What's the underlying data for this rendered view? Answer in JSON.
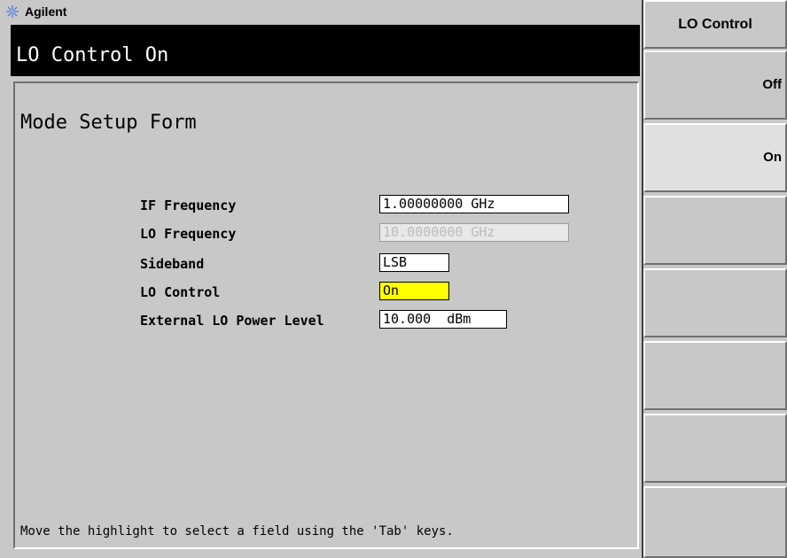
{
  "logo": {
    "brand": "Agilent"
  },
  "title_bar": {
    "text": "LO Control On"
  },
  "form": {
    "title": "Mode Setup Form",
    "rows": [
      {
        "label": "IF Frequency",
        "value": "1.00000000 GHz",
        "state": "normal"
      },
      {
        "label": "LO Frequency",
        "value": "10.0000000 GHz",
        "state": "disabled"
      },
      {
        "label": "Sideband",
        "value": "LSB",
        "state": "normal"
      },
      {
        "label": "LO Control",
        "value": "On",
        "state": "highlighted"
      },
      {
        "label": "External LO Power Level",
        "value": "10.000  dBm",
        "state": "normal"
      }
    ],
    "help": "Move the highlight to select a field using the 'Tab' keys."
  },
  "softkeys": {
    "title": "LO Control",
    "keys": [
      {
        "label": "Off"
      },
      {
        "label": "On"
      },
      {
        "label": ""
      },
      {
        "label": ""
      },
      {
        "label": ""
      },
      {
        "label": ""
      },
      {
        "label": ""
      }
    ]
  },
  "colors": {
    "background": "#c8c8c8",
    "title_bar": "#000000",
    "highlight": "#ffff00",
    "logo_star": "#4a78c8"
  }
}
